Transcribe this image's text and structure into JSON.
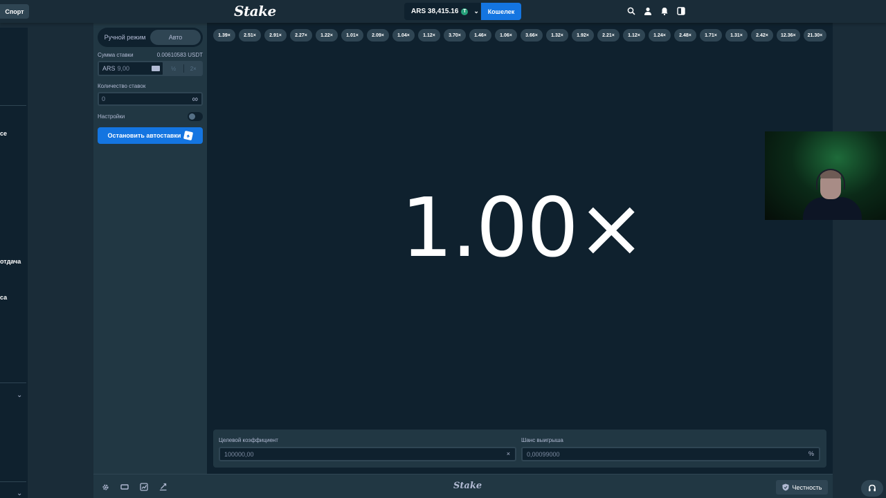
{
  "header": {
    "sport_tab": "Спорт",
    "logo": "Stake",
    "balance": "ARS 38,415.16",
    "coin_symbol": "T",
    "wallet_button": "Кошелек"
  },
  "leftnav": {
    "partial_labels": [
      "се",
      "отдача",
      "са"
    ]
  },
  "panel": {
    "modes": [
      "Ручной режим",
      "Авто"
    ],
    "active_mode": "Авто",
    "bet_amount_label": "Сумма ставки",
    "bet_amount_crypto": "0.00610583 USDT",
    "bet_currency": "ARS",
    "bet_value": "9,00",
    "half_button": "½",
    "double_button": "2×",
    "bet_count_label": "Количество ставок",
    "bet_count_value": "0",
    "infinity_symbol": "∞",
    "settings_label": "Настройки",
    "settings_enabled": false,
    "stop_button": "Остановить автоставки"
  },
  "history": [
    "1.39×",
    "2.51×",
    "2.91×",
    "2.27×",
    "1.22×",
    "1.01×",
    "2.09×",
    "1.04×",
    "1.12×",
    "3.70×",
    "1.46×",
    "1.06×",
    "3.66×",
    "1.32×",
    "1.92×",
    "2.21×",
    "1.12×",
    "1.24×",
    "2.48×",
    "1.71×",
    "1.31×",
    "2.42×",
    "12.36×",
    "21.30×"
  ],
  "game": {
    "multiplier": "1.00×"
  },
  "bottom": {
    "target_label": "Целевой коэффициент",
    "target_value": "100000,00",
    "target_suffix": "×",
    "chance_label": "Шанс выигрыша",
    "chance_value": "0,00099000",
    "chance_suffix": "%"
  },
  "toolbar": {
    "logo": "Stake",
    "fairness_button": "Честность"
  },
  "colors": {
    "background": "#1a2c38",
    "panel": "#213743",
    "stage": "#0f212e",
    "accent_blue": "#1475e1",
    "pill": "#2f4553"
  }
}
